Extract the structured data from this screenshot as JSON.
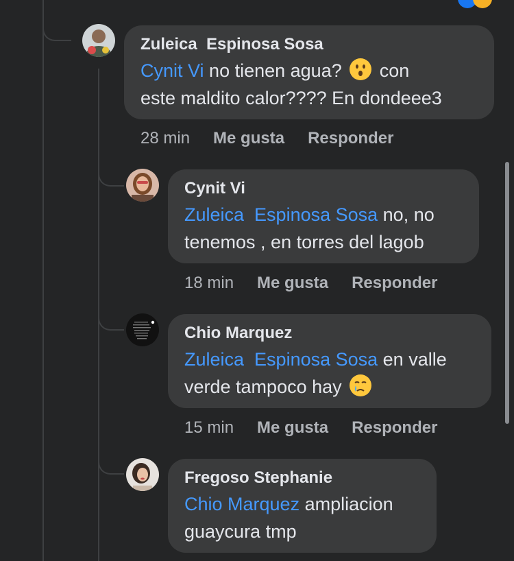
{
  "comments": [
    {
      "author": "Zuleica  Espinosa Sosa",
      "mention": "Cynit Vi",
      "text_line1": " no tienen agua? ",
      "text_after_emoji": " con",
      "text_line2": "este maldito calor???? En dondeee3",
      "emoji": "surprised-face",
      "time": "28 min",
      "like": "Me gusta",
      "reply": "Responder"
    },
    {
      "author": "Cynit Vi",
      "mention": "Zuleica  Espinosa Sosa",
      "text_line1": " no, no",
      "text_line2": "tenemos , en torres del lagob",
      "time": "18 min",
      "like": "Me gusta",
      "reply": "Responder"
    },
    {
      "author": "Chio Marquez",
      "mention": "Zuleica  Espinosa Sosa",
      "text_line1": " en valle",
      "text_line2": "verde tampoco hay ",
      "emoji": "crying-face",
      "time": "15 min",
      "like": "Me gusta",
      "reply": "Responder"
    },
    {
      "author": "Fregoso Stephanie",
      "mention": "Chio Marquez",
      "text_line1": " ampliacion",
      "text_line2": "guaycura tmp"
    }
  ],
  "colors": {
    "background": "#242526",
    "bubble": "#3a3b3c",
    "mention": "#4599ff",
    "meta": "#b0b3b8"
  }
}
